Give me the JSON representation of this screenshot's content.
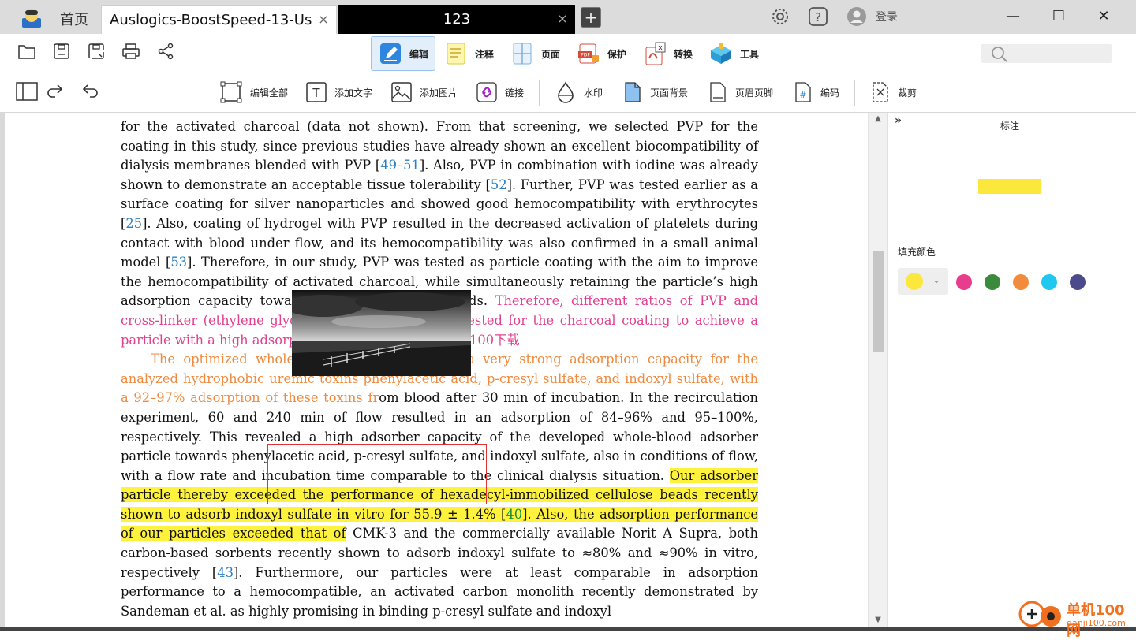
{
  "titlebar": {
    "home_tab": "首页",
    "tabs": [
      {
        "label": "Auslogics-BoostSpeed-13-Us...",
        "close": "×"
      },
      {
        "label": "123",
        "close": "×"
      }
    ],
    "new_tab": "+",
    "login": "登录",
    "window_buttons": {
      "minimize": "—",
      "maximize": "☐",
      "close": "✕"
    }
  },
  "ribbon": {
    "tabs": [
      {
        "label": "编辑",
        "icon": "edit-icon",
        "selected": true
      },
      {
        "label": "注释",
        "icon": "comment-icon"
      },
      {
        "label": "页面",
        "icon": "page-icon"
      },
      {
        "label": "保护",
        "icon": "protect-icon"
      },
      {
        "label": "转换",
        "icon": "convert-icon"
      },
      {
        "label": "工具",
        "icon": "tools-icon"
      }
    ],
    "quick_icons": [
      "open-folder-icon",
      "save-icon",
      "save-as-icon",
      "print-icon",
      "share-icon"
    ]
  },
  "edit_tools": {
    "edit_all": "编辑全部",
    "add_text": "添加文字",
    "add_image": "添加图片",
    "link": "链接",
    "watermark": "水印",
    "page_background": "页面背景",
    "header_footer": "页眉页脚",
    "numbering": "编码",
    "crop": "裁剪"
  },
  "document": {
    "p1_black": "for the activated charcoal (data not shown). From that screening, we selected PVP for the coating in this study, since previous studies have already shown an excellent biocompatibility of dialysis membranes blended with PVP [",
    "r49": "49",
    "dash": "–",
    "r51": "51",
    "p1_b": "]. Also, PVP in combination with iodine was already shown to demonstrate an acceptable tissue tolerability [",
    "r52": "52",
    "p1_c": "]. Further, PVP was tested earlier as a surface coating for silver nanoparticles and showed good hemocompatibility with erythrocytes [",
    "r25": "25",
    "p1_d": "]. Also, coating of hydrogel with PVP resulted in the decreased activation of platelets during contact with blood under flow, and its hemocompatibility was also confirmed in a small animal model [",
    "r53": "53",
    "p1_e": "]. Therefore, in our study, PVP was tested as particle coating with the aim to improve the hemocompatibility of activated charcoal, while simultaneously retaining the particle’s high adsorption capacity towards hydrophobic compounds. ",
    "p1_pink": "Therefore, different ratios of PVP and cross-linker (ethylene glycol dimethacrylate) were tested for the charcoal coating to achieve a particle with a high adsorption capacity (data not",
    "p1_pink_cn": "单机100下载",
    "p2_orange": "The optimized whole-blood adsorber showed a very strong adsorption capacity for the analyzed hydrophobic uremic toxins phenylacetic acid, p-cresyl sulfate, and indoxyl sulfate, with a 92–97% adsorption of these toxins fr",
    "p2_black": "om blood after 30 min of incubation.  In the recirculation experiment, 60 and 240 min of flow resulted in an adsorption of 84–96% and 95–100%, respectively. This revealed a high adsorber capacity of the developed whole-blood adsorber particle towards phenylacetic acid, p-cresyl sulfate, and indoxyl sulfate, also in conditions of flow, with a flow rate and incubation time comparable to the clinical dialysis situation. ",
    "p2_hl": "Our adsorber particle thereby exceeded the performance of hexadecyl-immobilized cellulose beads recently shown to adsorb indoxyl sulfate in vitro for 55.9 ± 1.4% [",
    "r40": "40",
    "p2_hl2": "].  Also, the adsorption performance of our particles exceeded that of",
    "p2_end": " CMK-3 and the commercially available Norit A Supra, both carbon-based sorbents recently shown to adsorb indoxyl sulfate to ≈80% and ≈90% in vitro, respectively [",
    "r43": "43",
    "p2_end2": "]. Furthermore, our particles were at least comparable in adsorption performance to a hemocompatible, an activated carbon monolith recently demonstrated by Sandeman et al. as highly promising in binding p-cresyl sulfate and indoxyl"
  },
  "side_panel": {
    "collapse": "»",
    "title": "标注",
    "fill_color_label": "填充颜色",
    "preview_color": "#fce83c",
    "selected_color": "#fce83c",
    "colors": [
      "#e83c8c",
      "#3c8a3c",
      "#f28c3c",
      "#1ec8f0",
      "#4a4a8c"
    ]
  },
  "watermark": {
    "line1": "单机100网",
    "line2": "danji100.com"
  },
  "colors": {
    "highlight": "#fff23d",
    "link": "#2a7fc4",
    "pink_text": "#e0418f",
    "orange_text": "#ef8a3f",
    "selection_border": "#e13333"
  }
}
